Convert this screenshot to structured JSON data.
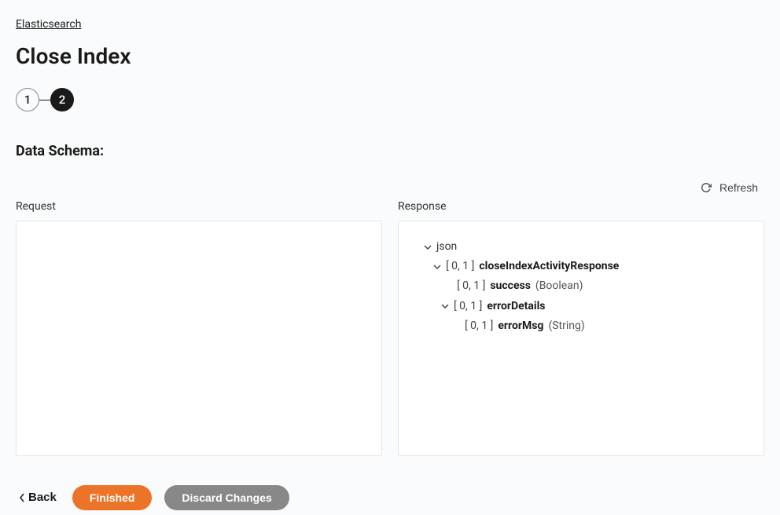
{
  "breadcrumb": {
    "root": "Elasticsearch"
  },
  "page": {
    "title": "Close Index"
  },
  "stepper": {
    "steps": [
      "1",
      "2"
    ],
    "active_index": 1
  },
  "section": {
    "title": "Data Schema:"
  },
  "actions": {
    "refresh": "Refresh",
    "back": "Back",
    "finished": "Finished",
    "discard": "Discard Changes"
  },
  "panels": {
    "request": {
      "label": "Request"
    },
    "response": {
      "label": "Response",
      "tree": {
        "root": "json",
        "nodes": [
          {
            "cardinality": "[ 0, 1 ]",
            "name": "closeIndexActivityResponse",
            "expandable": true,
            "children": [
              {
                "cardinality": "[ 0, 1 ]",
                "name": "success",
                "type": "(Boolean)",
                "expandable": false
              },
              {
                "cardinality": "[ 0, 1 ]",
                "name": "errorDetails",
                "expandable": true,
                "children": [
                  {
                    "cardinality": "[ 0, 1 ]",
                    "name": "errorMsg",
                    "type": "(String)",
                    "expandable": false
                  }
                ]
              }
            ]
          }
        ]
      }
    }
  }
}
